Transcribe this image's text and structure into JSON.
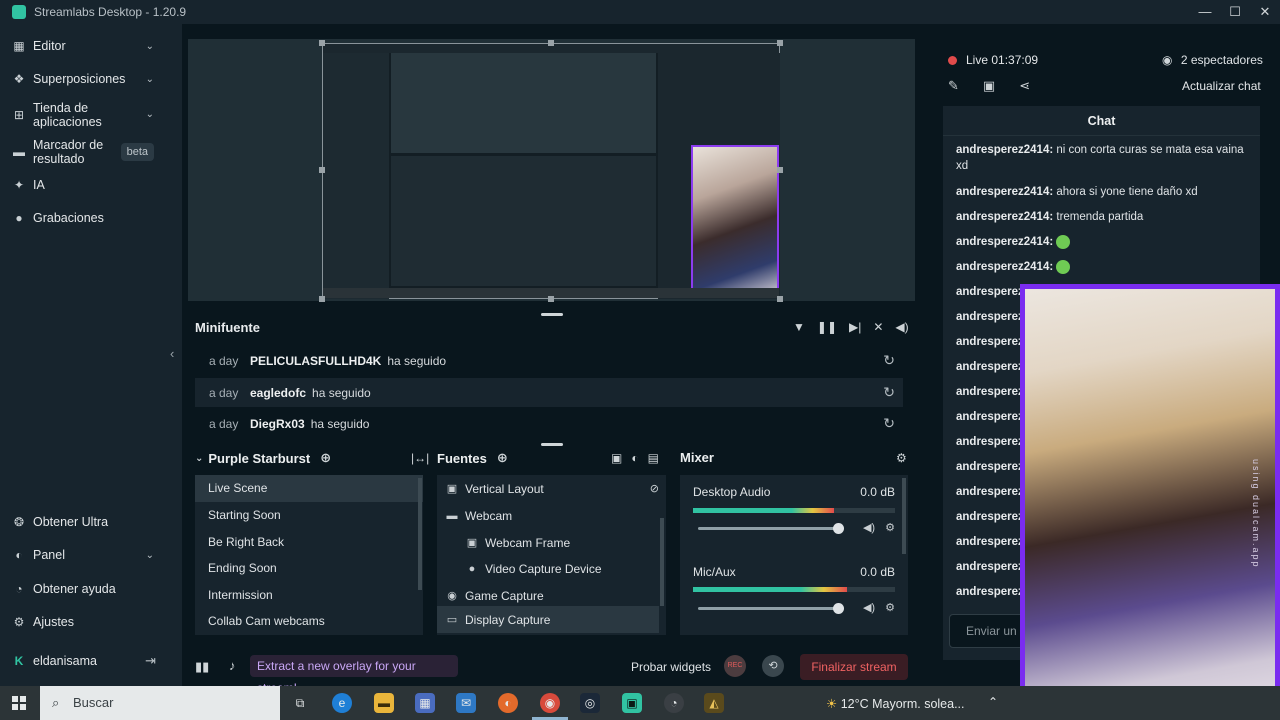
{
  "window": {
    "title": "Streamlabs Desktop - 1.20.9",
    "minimize": "—",
    "maximize": "☐",
    "close": "✕"
  },
  "sidebar": {
    "items": [
      {
        "label": "Editor",
        "icon": "grid-icon",
        "glyph": "▦"
      },
      {
        "label": "Superposiciones",
        "icon": "overlay-icon",
        "glyph": "❖"
      },
      {
        "label": "Tienda de aplicaciones",
        "icon": "store-icon",
        "glyph": "⊞"
      },
      {
        "label": "Marcador de resultado",
        "icon": "scoreboard-icon",
        "glyph": "▬",
        "badge": "beta"
      },
      {
        "label": "IA",
        "icon": "sparkle-icon",
        "glyph": "✦"
      },
      {
        "label": "Grabaciones",
        "icon": "recordings-icon",
        "glyph": "●"
      }
    ],
    "bottom": [
      {
        "label": "Obtener Ultra",
        "glyph": "❂"
      },
      {
        "label": "Panel",
        "glyph": "◐"
      },
      {
        "label": "Obtener ayuda",
        "glyph": "◔"
      },
      {
        "label": "Ajustes",
        "glyph": "⚙"
      }
    ],
    "user": {
      "name": "eldanisama",
      "glyph": "K",
      "logout": "⇥"
    }
  },
  "minifeed": {
    "title": "Minifuente",
    "rows": [
      {
        "ago": "a day",
        "user": "PELICULASFULLHD4K",
        "action": "ha seguido"
      },
      {
        "ago": "a day",
        "user": "eagledofc",
        "action": "ha seguido"
      },
      {
        "ago": "a day",
        "user": "DiegRx03",
        "action": "ha seguido"
      }
    ]
  },
  "scenes": {
    "title": "Purple Starburst",
    "items": [
      "Live Scene",
      "Starting Soon",
      "Be Right Back",
      "Ending Soon",
      "Intermission",
      "Collab Cam webcams"
    ],
    "active": 0
  },
  "sources": {
    "title": "Fuentes",
    "items": [
      {
        "label": "Vertical Layout",
        "glyph": "▣",
        "indent": 0
      },
      {
        "label": "Webcam",
        "glyph": "▬",
        "indent": 0
      },
      {
        "label": "Webcam Frame",
        "glyph": "▣",
        "indent": 1
      },
      {
        "label": "Video Capture Device",
        "glyph": "●",
        "indent": 1
      },
      {
        "label": "Game Capture",
        "glyph": "◉",
        "indent": 0
      },
      {
        "label": "Display Capture",
        "glyph": "▭",
        "indent": 0
      }
    ]
  },
  "mixer": {
    "title": "Mixer",
    "channels": [
      {
        "name": "Desktop Audio",
        "db": "0.0 dB",
        "level": 0.7
      },
      {
        "name": "Mic/Aux",
        "db": "0.0 dB",
        "level": 0.76
      }
    ]
  },
  "footer": {
    "tip": "Extract a new overlay for your stream!",
    "probar": "Probar widgets",
    "rec": "REC",
    "end_stream": "Finalizar stream"
  },
  "stream": {
    "live_label": "Live",
    "time": "01:37:09",
    "viewers": "2 espectadores",
    "refresh_chat": "Actualizar chat"
  },
  "chat": {
    "title": "Chat",
    "messages": [
      {
        "user": "andresperez2414:",
        "text": "ni con corta curas se mata esa vaina xd"
      },
      {
        "user": "andresperez2414:",
        "text": "ahora si yone tiene daño xd"
      },
      {
        "user": "andresperez2414:",
        "text": "tremenda partida"
      },
      {
        "user": "andresperez2414:",
        "text": ""
      },
      {
        "user": "andresperez2414:",
        "text": ""
      },
      {
        "user": "andresperez",
        "text": ""
      },
      {
        "user": "andresperez",
        "text": ""
      },
      {
        "user": "andresperez",
        "text": ""
      },
      {
        "user": "andresperez",
        "text": ""
      },
      {
        "user": "andresperez",
        "text": ""
      },
      {
        "user": "andresperez",
        "text": ""
      },
      {
        "user": "andresperez",
        "text": ""
      },
      {
        "user": "andresperez",
        "text": ""
      },
      {
        "user": "andresperez",
        "text": ""
      },
      {
        "user": "andresperez",
        "text": ""
      },
      {
        "user": "andresperez",
        "text": ""
      },
      {
        "user": "andresperez",
        "text": ""
      },
      {
        "user": "andresperez",
        "text": ""
      }
    ],
    "input_placeholder": "Enviar un"
  },
  "webcam": {
    "watermark": "using dualcam.app"
  },
  "taskbar": {
    "search": "Buscar",
    "weather": "12°C  Mayorm. solea..."
  },
  "colors": {
    "accent": "#31c3a2",
    "live": "#e14b4b",
    "end_stream": "#f06262",
    "webcam_border": "#7a2cf0"
  }
}
